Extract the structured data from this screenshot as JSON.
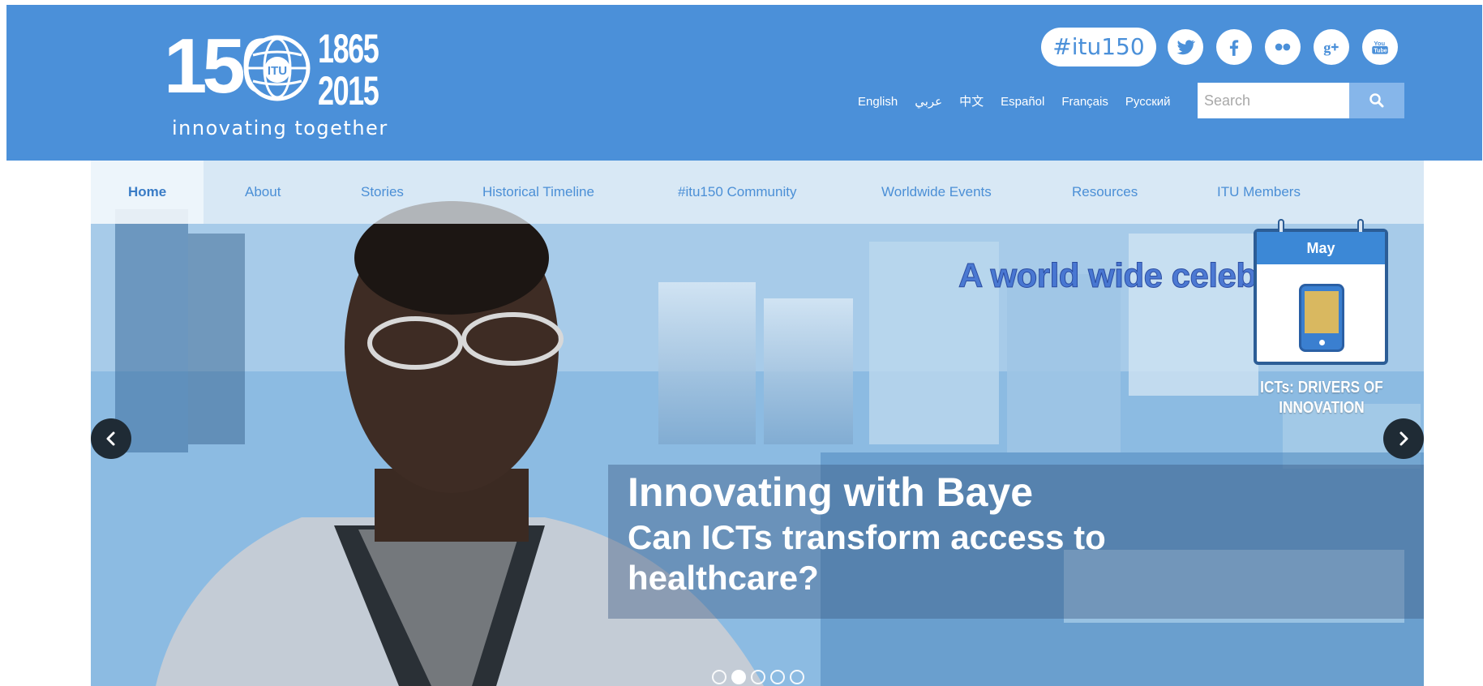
{
  "logo": {
    "number": "150",
    "globe_text": "ITU",
    "year_start": "1865",
    "year_end": "2015",
    "tagline": "innovating together"
  },
  "header": {
    "hashtag": "#itu150",
    "social_icons": [
      "twitter-icon",
      "facebook-icon",
      "flickr-icon",
      "google-plus-icon",
      "youtube-icon"
    ],
    "languages": [
      "English",
      "عربي",
      "中文",
      "Español",
      "Français",
      "Русский"
    ],
    "search": {
      "placeholder": "Search"
    }
  },
  "nav": {
    "items": [
      "Home",
      "About",
      "Stories",
      "Historical Timeline",
      "#itu150 Community",
      "Worldwide Events",
      "Resources",
      "ITU Members"
    ],
    "active": "Home"
  },
  "hero": {
    "banner_text": "A world wide celebration",
    "calendar_month": "May",
    "calendar_caption": "ICTs: DRIVERS OF INNOVATION",
    "caption_title": "Innovating with Baye",
    "caption_subtitle": "Can ICTs transform access to healthcare?",
    "slide_count": 5,
    "active_slide": 2
  },
  "colors": {
    "header_bg": "#4b90d9",
    "nav_text": "#4b8fd6",
    "search_button": "#86b6ea",
    "arrow_bg": "#1f2b35"
  }
}
